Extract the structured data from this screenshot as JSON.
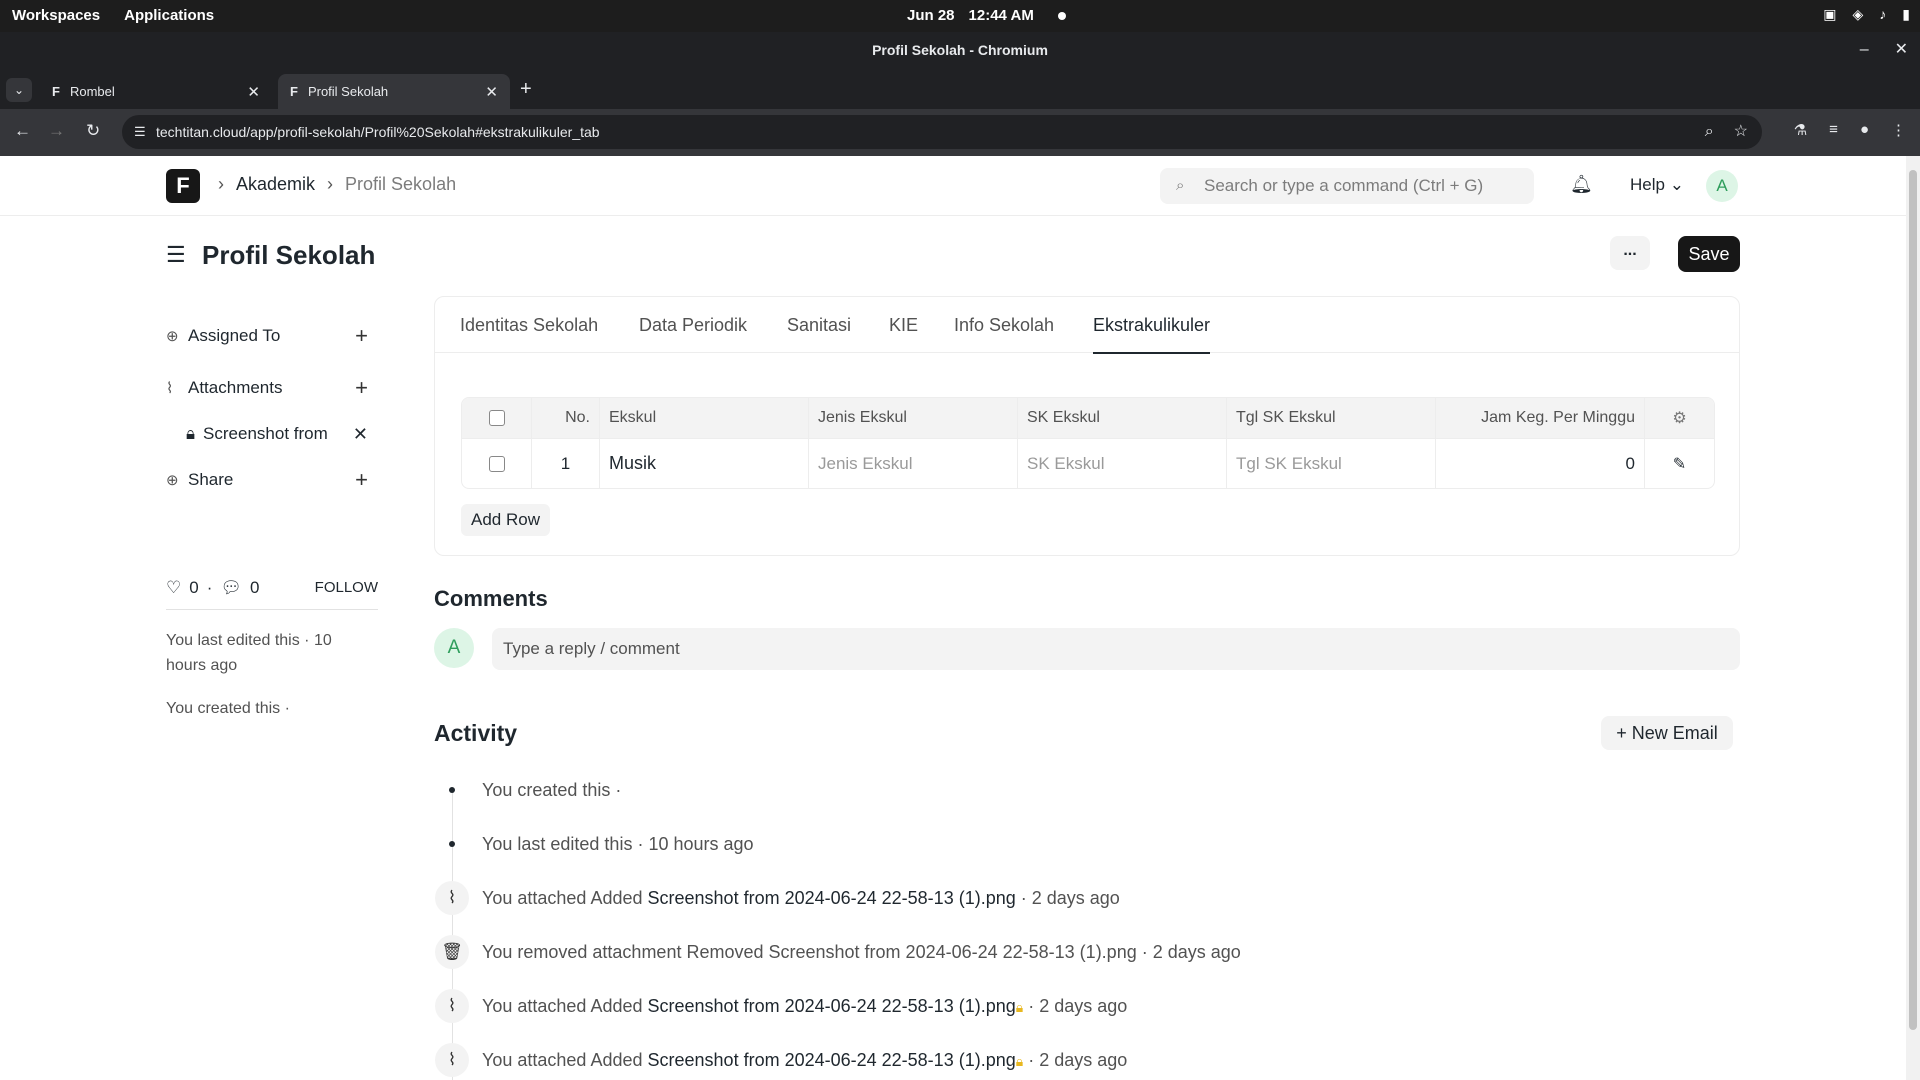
{
  "system_bar": {
    "workspaces": "Workspaces",
    "applications": "Applications",
    "date": "Jun 28",
    "time": "12:44 AM"
  },
  "window": {
    "title": "Profil Sekolah - Chromium"
  },
  "browser": {
    "tabs": [
      {
        "label": "Rombel"
      },
      {
        "label": "Profil Sekolah"
      }
    ],
    "url": "techtitan.cloud/app/profil-sekolah/Profil%20Sekolah#ekstrakulikuler_tab"
  },
  "app_header": {
    "breadcrumb_parent": "Akademik",
    "breadcrumb_current": "Profil Sekolah",
    "search_placeholder": "Search or type a command (Ctrl + G)",
    "help_label": "Help",
    "avatar_letter": "A"
  },
  "page": {
    "title": "Profil Sekolah",
    "more_label": "...",
    "save_label": "Save"
  },
  "sidebar": {
    "assigned_to": "Assigned To",
    "attachments": "Attachments",
    "attachment_item": "Screenshot from",
    "share": "Share",
    "likes_count": "0",
    "comments_count": "0",
    "follow": "FOLLOW",
    "last_edited": "You last edited this · 10 hours ago",
    "created": "You created this ·"
  },
  "form_tabs": [
    {
      "label": "Identitas Sekolah"
    },
    {
      "label": "Data Periodik"
    },
    {
      "label": "Sanitasi"
    },
    {
      "label": "KIE"
    },
    {
      "label": "Info Sekolah"
    },
    {
      "label": "Ekstrakulikuler"
    }
  ],
  "grid": {
    "headers": {
      "no": "No.",
      "ekskul": "Ekskul",
      "jenis": "Jenis Ekskul",
      "sk": "SK Ekskul",
      "tgl": "Tgl SK Ekskul",
      "jam": "Jam Keg. Per Minggu"
    },
    "rows": [
      {
        "no": "1",
        "ekskul": "Musik",
        "jenis": "Jenis Ekskul",
        "sk": "SK Ekskul",
        "tgl": "Tgl SK Ekskul",
        "jam": "0"
      }
    ],
    "add_row": "Add Row"
  },
  "comments": {
    "heading": "Comments",
    "avatar_letter": "A",
    "placeholder": "Type a reply / comment"
  },
  "activity": {
    "heading": "Activity",
    "new_email": "New Email",
    "items": [
      {
        "pre": "You created this ·",
        "file": "",
        "post": ""
      },
      {
        "pre": "You last edited this · 10 hours ago",
        "file": "",
        "post": ""
      },
      {
        "pre": "You attached Added",
        "file": "Screenshot from 2024-06-24 22-58-13 (1).png",
        "post": "· 2 days ago"
      },
      {
        "pre": "You removed attachment Removed Screenshot from 2024-06-24 22-58-13 (1).png · 2 days ago",
        "file": "",
        "post": ""
      },
      {
        "pre": "You attached Added",
        "file": "Screenshot from 2024-06-24 22-58-13 (1).png",
        "post": "· 2 days ago"
      },
      {
        "pre": "You attached Added",
        "file": "Screenshot from 2024-06-24 22-58-13 (1).png",
        "post": "· 2 days ago"
      }
    ]
  }
}
